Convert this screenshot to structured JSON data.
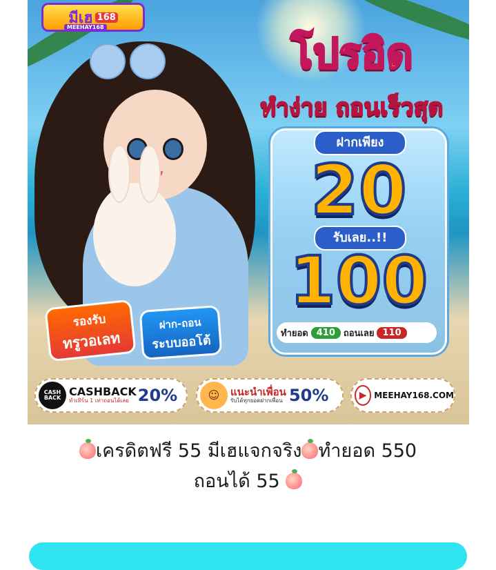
{
  "banner": {
    "logo_main": "มีเฮ",
    "logo_badge": "168",
    "logo_sub": "MEEHAY168",
    "headline": "โปรอิด",
    "subhead": "ทำง่าย ถอนเร็วสุด",
    "deposit_label": "ฝากเพียง",
    "deposit_amount": "20",
    "receive_label": "รับเลย..!!",
    "receive_amount": "100",
    "turnover_label": "ทำยอด",
    "turnover_value": "410",
    "withdraw_label": "ถอนเลย",
    "withdraw_value": "110",
    "badge_wallet_line1": "รองรับ",
    "badge_wallet_line2": "ทรูวอเลท",
    "badge_auto_line1": "ฝาก-ถอน",
    "badge_auto_line2": "ระบบออโต้",
    "cashback_icon": "CASH BACK",
    "cashback_title": "CASHBACK",
    "cashback_percent": "20%",
    "cashback_note": "ทำเทิร์น 1 เท่าถอนได้เลย",
    "referral_title": "แนะนำเพื่อน",
    "referral_percent": "50%",
    "referral_note": "รับได้ทุกยอดฝากเพื่อน",
    "site_url": "MEEHAY168.COM"
  },
  "caption": {
    "line1_text": "เครดิตฟรี 55 มีเฮแจกจริง",
    "line1_tail": "ทำยอด 550",
    "line2_text": "ถอนได้ 55"
  },
  "colors": {
    "cta_bar": "#2fe3f0",
    "headline": "#ffcd22",
    "panel_pill": "#2c5ec9"
  }
}
